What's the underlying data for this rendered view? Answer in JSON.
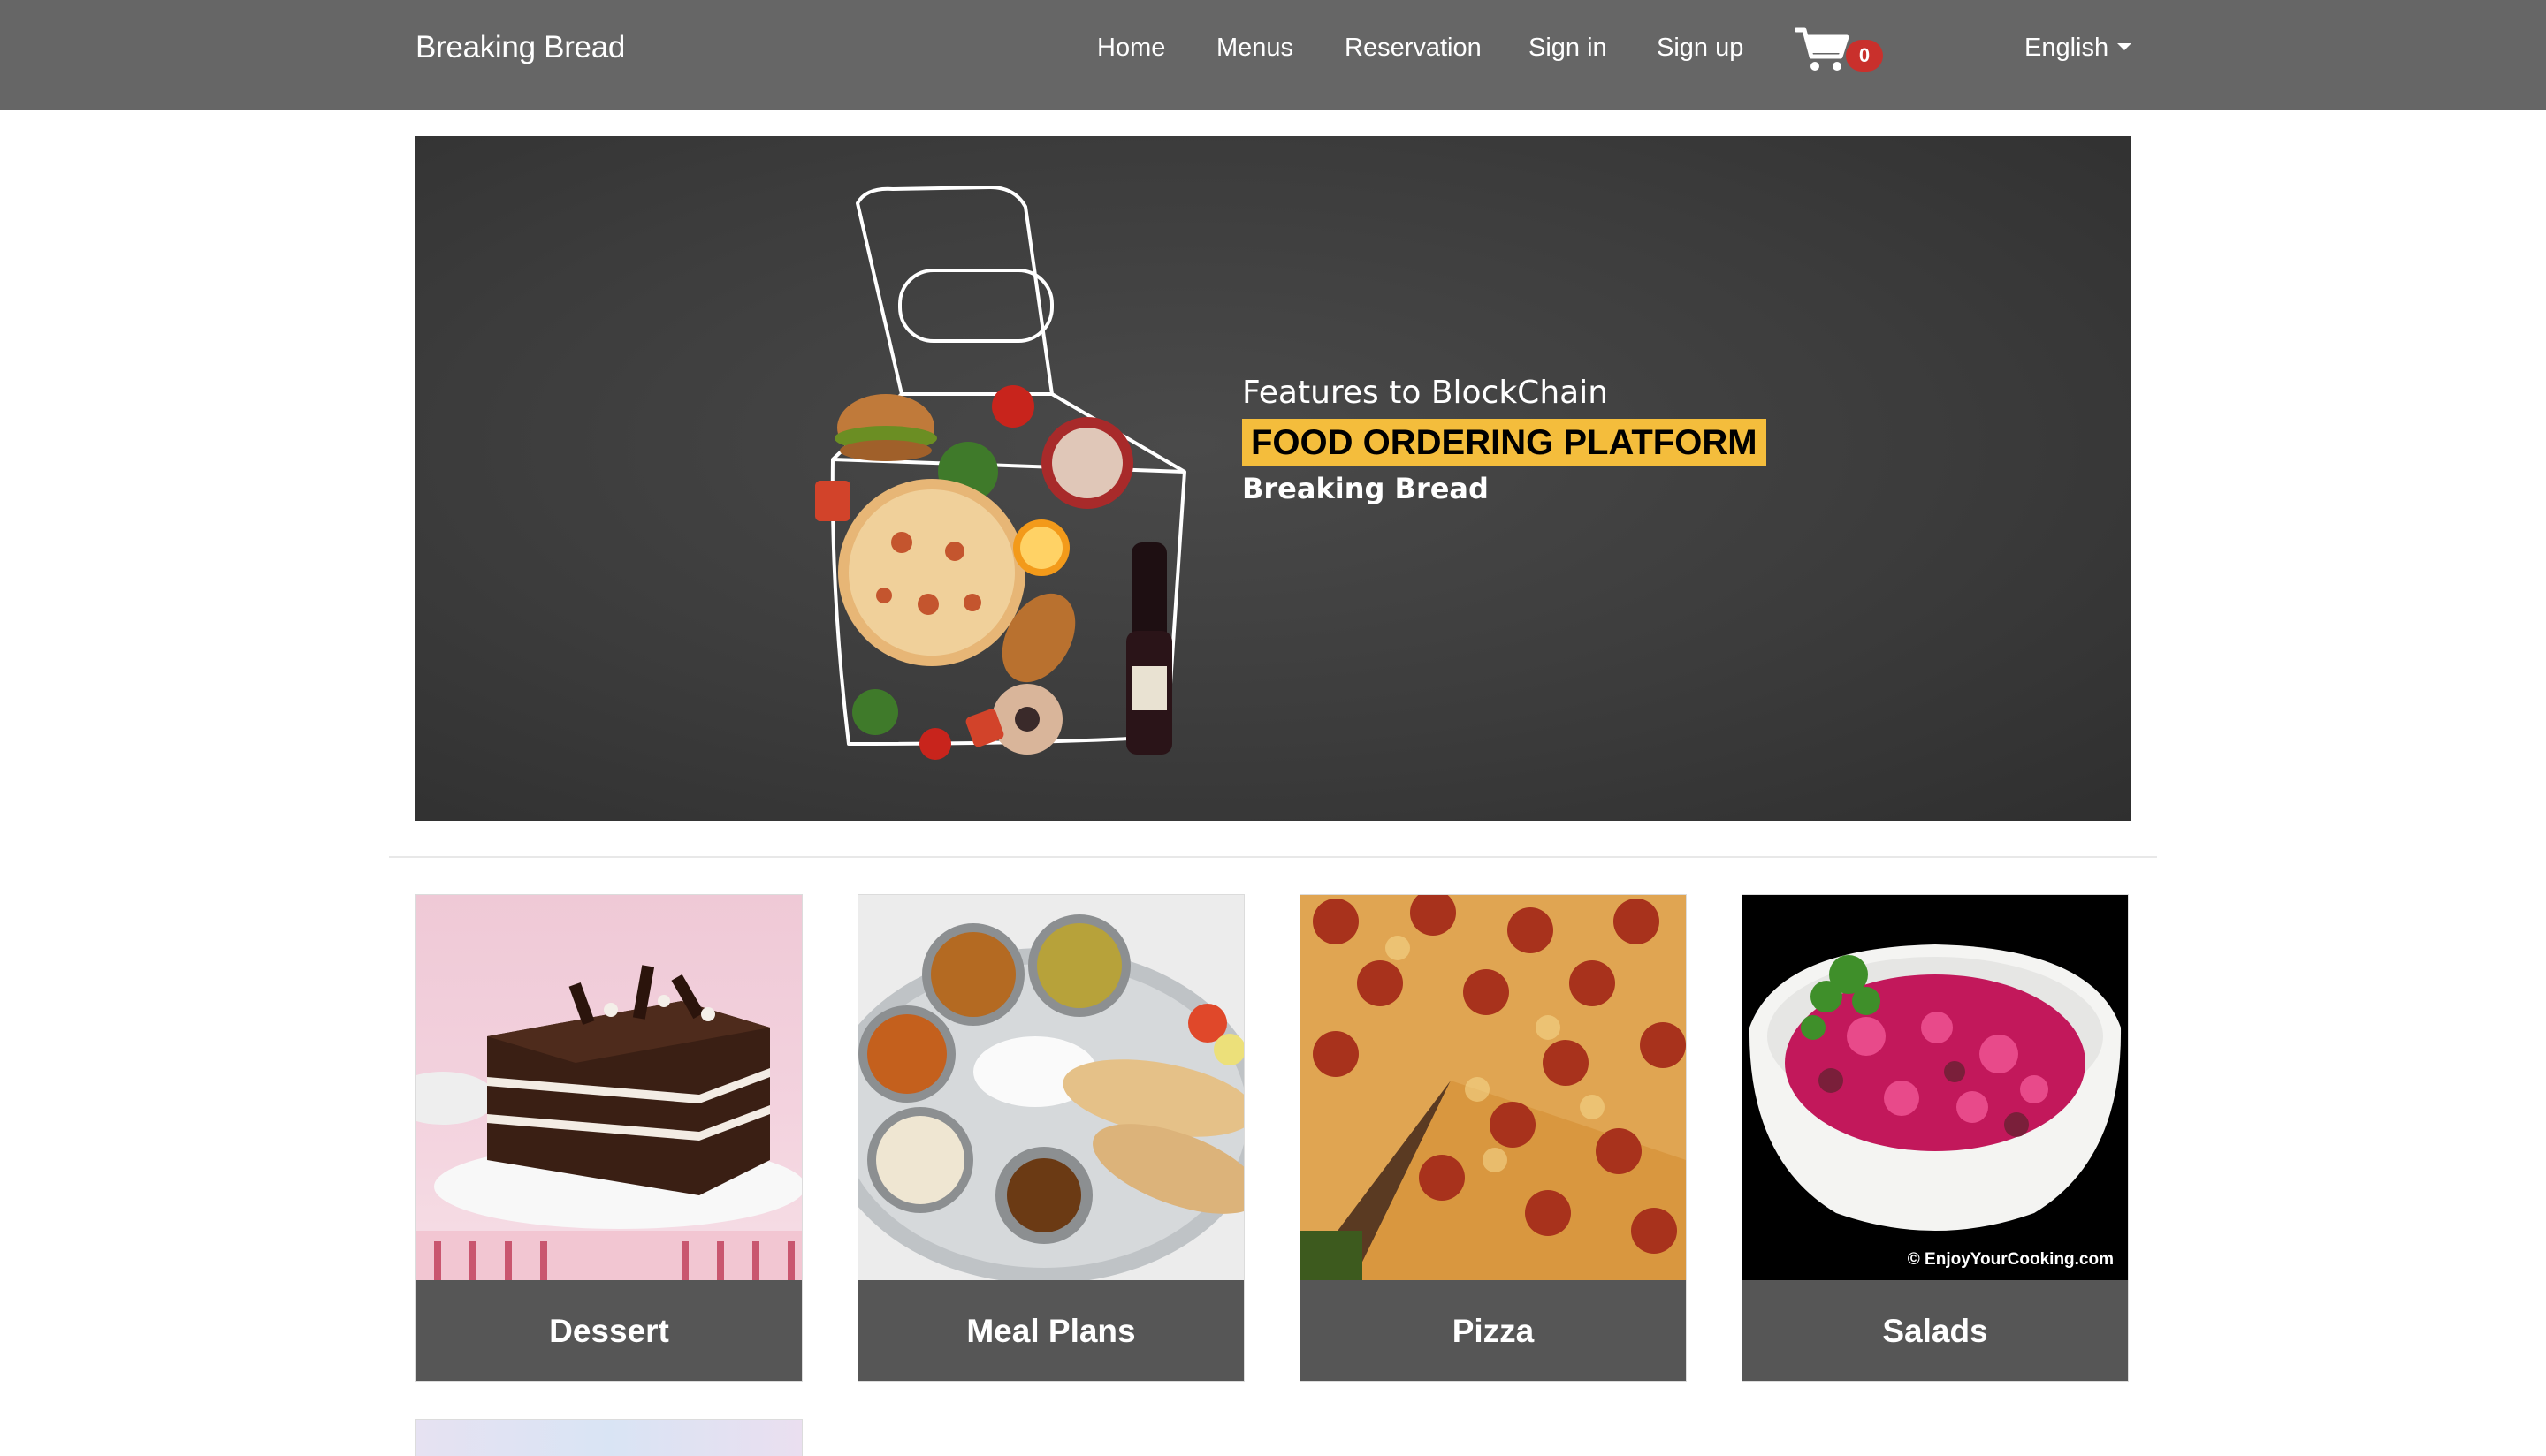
{
  "nav": {
    "brand": "Breaking Bread",
    "links": [
      "Home",
      "Menus",
      "Reservation",
      "Sign in",
      "Sign up"
    ],
    "cart_icon": "shopping-cart-icon",
    "cart_count": "0",
    "language": "English"
  },
  "hero": {
    "line1": "Features to BlockChain",
    "line2": "FOOD ORDERING PLATFORM",
    "line3": "Breaking Bread",
    "highlight_color": "#f4bd3c"
  },
  "categories": [
    {
      "label": "Dessert"
    },
    {
      "label": "Meal Plans"
    },
    {
      "label": "Pizza"
    },
    {
      "label": "Salads",
      "watermark": "© EnjoyYourCooking.com"
    }
  ],
  "colors": {
    "navbar": "#666666",
    "card_label_bg": "#565656",
    "badge": "#c9302c"
  }
}
